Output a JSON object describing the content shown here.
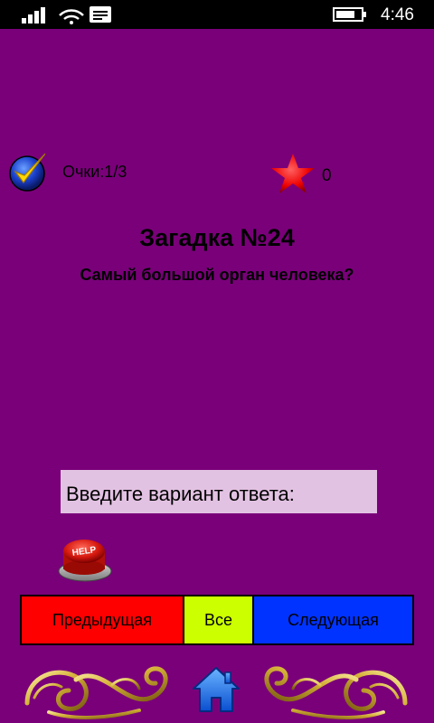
{
  "status_bar": {
    "time": "4:46",
    "icons": [
      "signal-icon",
      "wifi-icon",
      "message-icon",
      "battery-icon"
    ]
  },
  "score": {
    "label": "Очки:1/3",
    "stars": "0",
    "icons": [
      "check-icon",
      "star-icon"
    ]
  },
  "riddle": {
    "title": "Загадка №24",
    "question": "Самый большой орган человека?"
  },
  "answer": {
    "placeholder": "Введите вариант ответа:",
    "value": ""
  },
  "help": {
    "label": "HELP"
  },
  "nav": {
    "prev": "Предыдущая",
    "all": "Все",
    "next": "Следующая"
  },
  "colors": {
    "background": "#7a007a",
    "prev_button": "#ff0000",
    "all_button": "#ccff00",
    "next_button": "#0033ff",
    "input_background": "#e2c2e2",
    "star": "#ff1a1a",
    "gold": "#d4af37"
  }
}
